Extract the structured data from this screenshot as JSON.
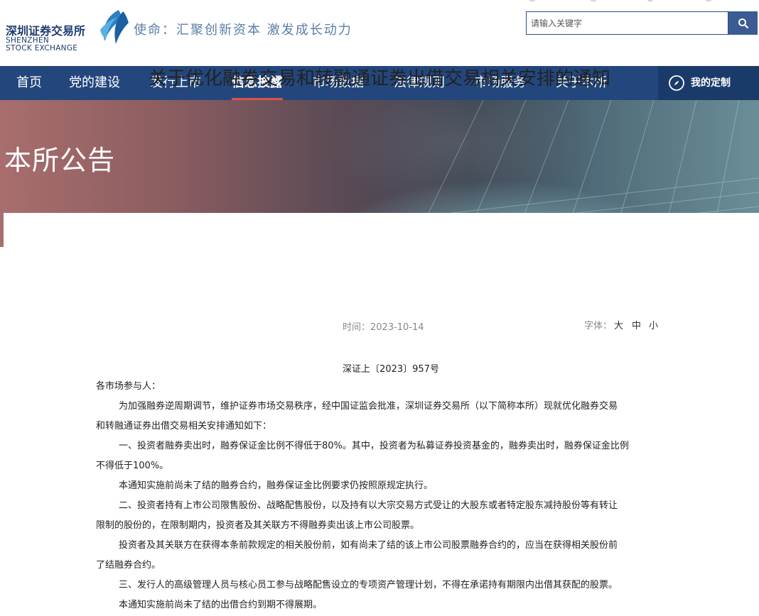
{
  "header": {
    "logo_cn": "深圳证券交易所",
    "logo_en_line1": "SHENZHEN",
    "logo_en_line2": "STOCK EXCHANGE",
    "slogan": "使命：汇聚创新资本 激发成长动力",
    "search_placeholder": "请输入关键字",
    "brand_color": "#23477c"
  },
  "nav": {
    "items": [
      "首页",
      "党的建设",
      "发行上市",
      "信息披露",
      "市场数据",
      "法律规则",
      "市场服务",
      "关于本所"
    ],
    "active": "信息披露",
    "custom_label": "我的定制"
  },
  "banner": {
    "title": "本所公告"
  },
  "article": {
    "title": "关于优化融券交易和转融通证券出借交易相关安排的通知",
    "time_label": "时间：2023-10-14",
    "font_label": "字体：",
    "font_options": [
      "大",
      "中",
      "小"
    ],
    "doc_number": "深证上〔2023〕957号",
    "paragraphs": [
      "各市场参与人：",
      "为加强融券逆周期调节，维护证券市场交易秩序，经中国证监会批准，深圳证券交易所（以下简称本所）现就优化融券交易",
      "和转融通证券出借交易相关安排通知如下：",
      "一、投资者融券卖出时，融券保证金比例不得低于80%。其中，投资者为私募证券投资基金的，融券卖出时，融券保证金比例",
      "不得低于100%。",
      "本通知实施前尚未了结的融券合约，融券保证金比例要求仍按照原规定执行。",
      "二、投资者持有上市公司限售股份、战略配售股份，以及持有以大宗交易方式受让的大股东或者特定股东减持股份等有转让",
      "限制的股份的，在限制期内，投资者及其关联方不得融券卖出该上市公司股票。",
      "投资者及其关联方在获得本条前款规定的相关股份前，如有尚未了结的该上市公司股票融券合约的，应当在获得相关股份前",
      "了结融券合约。",
      "三、发行人的高级管理人员与核心员工参与战略配售设立的专项资产管理计划，不得在承诺持有期限内出借其获配的股票。",
      "本通知实施前尚未了结的出借合约到期不得展期。"
    ]
  }
}
